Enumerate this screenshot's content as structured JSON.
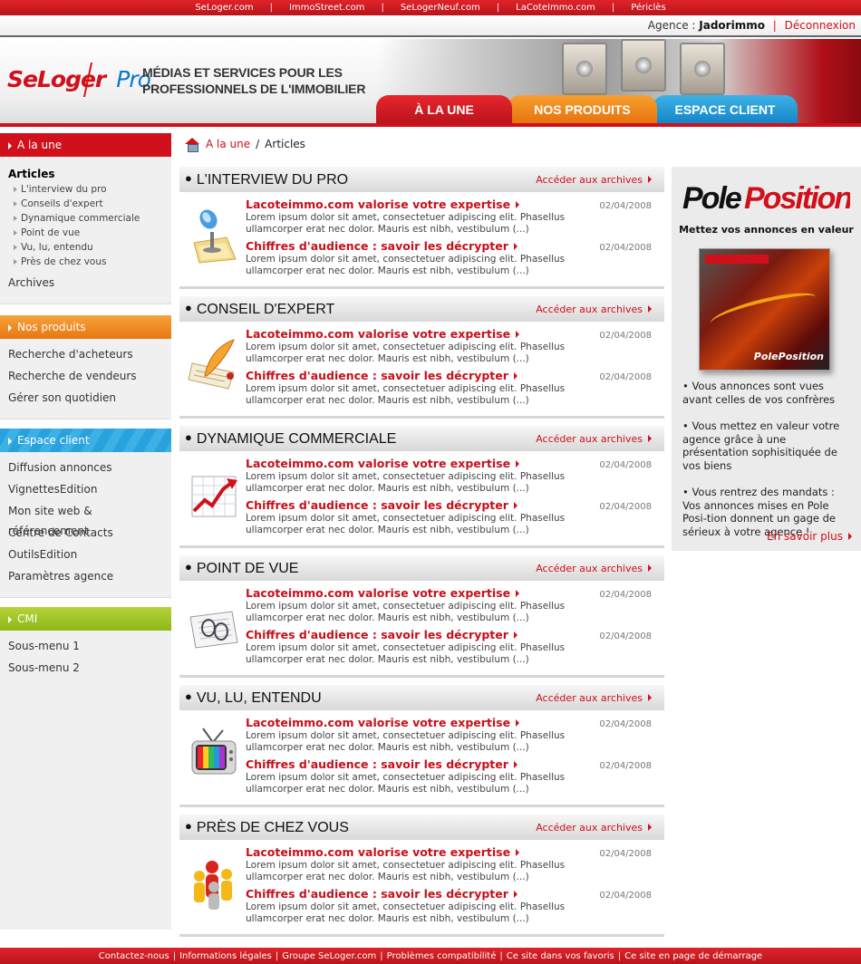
{
  "topbar": {
    "links": [
      "SeLoger.com",
      "ImmoStreet.com",
      "SeLogerNeuf.com",
      "LaCoteImmo.com",
      "Périclès"
    ],
    "sep": "|"
  },
  "agency": {
    "label": "Agence :",
    "name": "Jadorimmo",
    "sep": "|",
    "logout": "Déconnexion"
  },
  "header": {
    "logo_main": "SeLoger",
    "logo_pro": "Pro",
    "tagline_1": "MÉDIAS ET SERVICES POUR LES",
    "tagline_2": "PROFESSIONNELS DE L'IMMOBILIER",
    "tabs": [
      "À LA UNE",
      "NOS PRODUITS",
      "ESPACE CLIENT"
    ]
  },
  "sidebar": {
    "s1": {
      "title": "A la une",
      "current": "Articles",
      "subs": [
        "L'interview du pro",
        "Conseils d'expert",
        "Dynamique commerciale",
        "Point de vue",
        "Vu, lu, entendu",
        "Près de chez vous"
      ],
      "archives": "Archives"
    },
    "s2": {
      "title": "Nos produits",
      "items": [
        "Recherche d'acheteurs",
        "Recherche de vendeurs",
        "Gérer son quotidien"
      ]
    },
    "s3": {
      "title": "Espace client",
      "items": [
        "Diffusion annonces",
        "VignettesEdition",
        "Mon site web & référencement",
        "Centre de Contacts",
        "OutilsEdition",
        "Paramètres agence"
      ]
    },
    "s4": {
      "title": "CMI",
      "items": [
        "Sous-menu 1",
        "Sous-menu 2"
      ]
    }
  },
  "breadcrumb": {
    "home": "A la une",
    "sep": "/",
    "current": "Articles"
  },
  "archives_label": "Accéder aux archives",
  "sections": [
    {
      "title": "L'INTERVIEW DU PRO",
      "icon": "microphone-icon"
    },
    {
      "title": "CONSEIL D'EXPERT",
      "icon": "quill-letter-icon"
    },
    {
      "title": "DYNAMIQUE COMMERCIALE",
      "icon": "growth-chart-icon"
    },
    {
      "title": "POINT DE VUE",
      "icon": "glasses-document-icon"
    },
    {
      "title": "VU, LU, ENTENDU",
      "icon": "television-icon"
    },
    {
      "title": "PRÈS DE CHEZ VOUS",
      "icon": "people-icon"
    }
  ],
  "article1": {
    "title": "Lacoteimmo.com valorise votre expertise",
    "date": "02/04/2008",
    "text": "Lorem ipsum dolor sit amet, consectetuer adipiscing elit. Phasellus ullamcorper erat nec dolor. Mauris est nibh, vestibulum (...)"
  },
  "article2": {
    "title": "Chiffres d'audience : savoir les décrypter",
    "date": "02/04/2008",
    "text": "Lorem ipsum dolor sit amet, consectetuer adipiscing elit. Phasellus ullamcorper erat nec dolor. Mauris est nibh, vestibulum (...)"
  },
  "promo": {
    "logo": "PolePosition",
    "tagline": "Mettez vos annonces en valeur",
    "box_text": "PolePosition",
    "box_brand": "SeLoger",
    "bullets": [
      "• Vous annonces sont vues avant celles de vos confrères",
      "• Vous mettez en valeur votre agence grâce à une présentation sophisitiquée de vos biens",
      "• Vous rentrez des mandats : Vos annonces mises en Pole Posi-tion donnent un gage de sérieux à votre agence !"
    ],
    "more": "En savoir plus"
  },
  "footer": {
    "links": [
      "Contactez-nous",
      "Informations légales",
      "Groupe SeLoger.com",
      "Problèmes compatibilité",
      "Ce site dans vos favoris",
      "Ce site en page de démarrage"
    ],
    "sep": "|"
  },
  "colors": {
    "brand_red": "#d0101a",
    "orange": "#e87713",
    "blue": "#1d8fd0",
    "green": "#8db718"
  }
}
